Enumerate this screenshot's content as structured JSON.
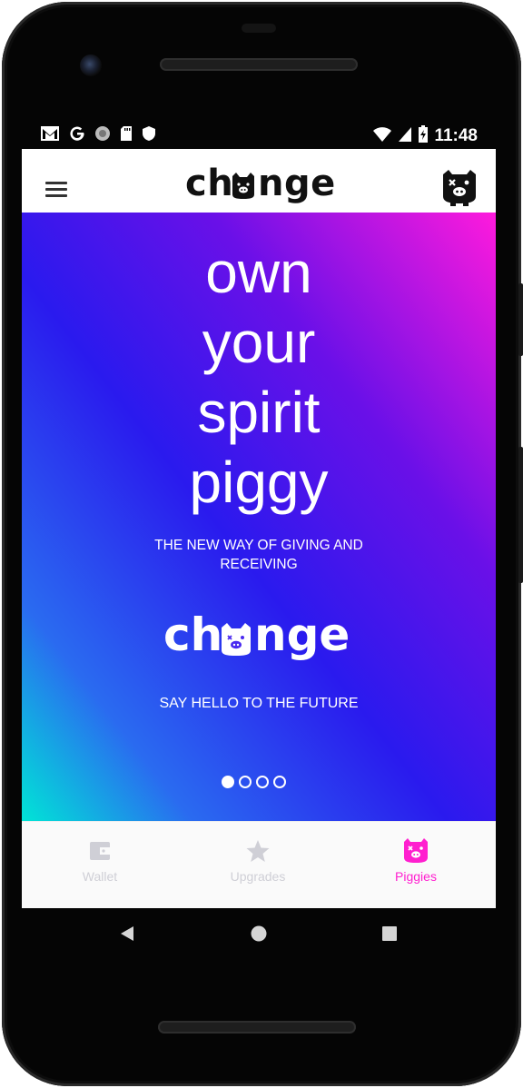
{
  "status_bar": {
    "time": "11:48",
    "left_icons": [
      "gmail-icon",
      "google-icon",
      "circle-icon",
      "sd-card-icon",
      "shield-icon"
    ],
    "right_icons": [
      "wifi-icon",
      "signal-icon",
      "battery-icon"
    ]
  },
  "app_bar": {
    "logo": "change",
    "menu_icon": "menu-icon",
    "profile_icon": "pig-avatar-icon"
  },
  "hero": {
    "headline": [
      "own",
      "your",
      "spirit",
      "piggy"
    ],
    "subtitle": "THE NEW WAY OF GIVING AND RECEIVING",
    "logo": "change",
    "tagline": "SAY HELLO TO THE FUTURE",
    "pager": {
      "count": 4,
      "active": 0
    },
    "gradient": [
      "#00e5d6",
      "#2a1aee",
      "#ff1adc"
    ]
  },
  "bottom_nav": {
    "items": [
      {
        "label": "Wallet",
        "icon": "wallet-icon",
        "active": false
      },
      {
        "label": "Upgrades",
        "icon": "star-icon",
        "active": false
      },
      {
        "label": "Piggies",
        "icon": "pig-icon",
        "active": true
      }
    ],
    "active_color": "#ff1fcf",
    "inactive_color": "#cfcfd6"
  },
  "system_nav": {
    "buttons": [
      "back-icon",
      "home-icon",
      "recents-icon"
    ]
  }
}
